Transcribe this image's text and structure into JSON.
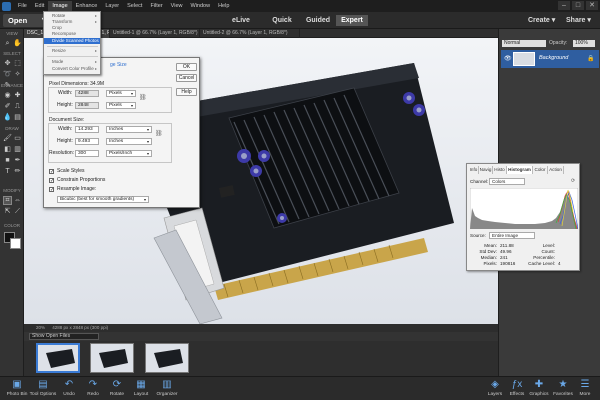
{
  "menubar": {
    "items": [
      "File",
      "Edit",
      "Image",
      "Enhance",
      "Layer",
      "Select",
      "Filter",
      "View",
      "Window",
      "Help"
    ],
    "active": "Image",
    "window_buttons": [
      "–",
      "□",
      "✕"
    ]
  },
  "topbar": {
    "open_label": "Open",
    "modes": [
      "eLive",
      "Quick",
      "Guided",
      "Expert"
    ],
    "active_mode": "Expert",
    "create_label": "Create",
    "share_label": "Share"
  },
  "tabs": [
    "DSC_1066.JPG @ 16.7% (Layer 1, RGB/8*)",
    "Untitled-1 @ 66.7% (Layer 1, RGB/8*)",
    "Untitled-2 @ 66.7% (Layer 1, RGB/8*)"
  ],
  "toolbar": {
    "sections": [
      "VIEW",
      "SELECT",
      "ENHANCE",
      "DRAW",
      "MODIFY",
      "COLOR"
    ]
  },
  "image_menu": {
    "items": [
      "Rotate",
      "Transform",
      "Crop",
      "Recompose",
      "Divide Scanned Photos",
      "Resize",
      "Mode",
      "Convert Color Profile"
    ],
    "highlighted": "Divide Scanned Photos"
  },
  "image_size_dialog": {
    "learn_more_label": "ge Size",
    "ok_label": "OK",
    "cancel_label": "Cancel",
    "help_label": "Help",
    "pixel_dimensions_label": "Pixel Dimensions: 34.9M",
    "width_label": "Width:",
    "height_label": "Height:",
    "pixel_width": "4288",
    "pixel_height": "2848",
    "pixel_unit": "Pixels",
    "document_size_label": "Document Size:",
    "doc_width": "14.293",
    "doc_height": "9.493",
    "doc_unit": "Inches",
    "resolution_label": "Resolution:",
    "resolution": "300",
    "resolution_unit": "Pixels/Inch",
    "scale_styles_label": "Scale Styles",
    "constrain_label": "Constrain Proportions",
    "resample_label": "Resample Image:",
    "resample_method": "Bicubic (best for smooth gradients)"
  },
  "canvas_status": {
    "zoom": "20%",
    "info": "4288 px x 2848 px (300 ppi)"
  },
  "photo_bin": {
    "selector": "Show Open Files"
  },
  "layers_panel": {
    "blend_mode": "Normal",
    "opacity_label": "Opacity:",
    "opacity": "100%",
    "layer_name": "Background"
  },
  "histogram_panel": {
    "tabs": [
      "Info",
      "Navig",
      "Histo",
      "Histogram",
      "Color",
      "Action"
    ],
    "active_tab": "Histogram",
    "channel_label": "Channel:",
    "channel": "Colors",
    "source_label": "Source:",
    "source": "Entire Image",
    "stats_left": [
      {
        "label": "Mean:",
        "value": "211.88"
      },
      {
        "label": "Std Dev:",
        "value": "49.96"
      },
      {
        "label": "Median:",
        "value": "241"
      },
      {
        "label": "Pixels:",
        "value": "190816"
      }
    ],
    "stats_right": [
      {
        "label": "Level:",
        "value": ""
      },
      {
        "label": "Count:",
        "value": ""
      },
      {
        "label": "Percentile:",
        "value": ""
      },
      {
        "label": "Cache Level:",
        "value": "4"
      }
    ]
  },
  "bottombar": {
    "left": [
      "Photo Bin",
      "Tool Options",
      "Undo",
      "Redo",
      "Rotate",
      "Layout",
      "Organizer"
    ],
    "right": [
      "Layers",
      "Effects",
      "Graphics",
      "Favorites",
      "More"
    ]
  },
  "colors": {
    "accent": "#2f6fcf",
    "bottom_icon": "#6aa8e8"
  }
}
